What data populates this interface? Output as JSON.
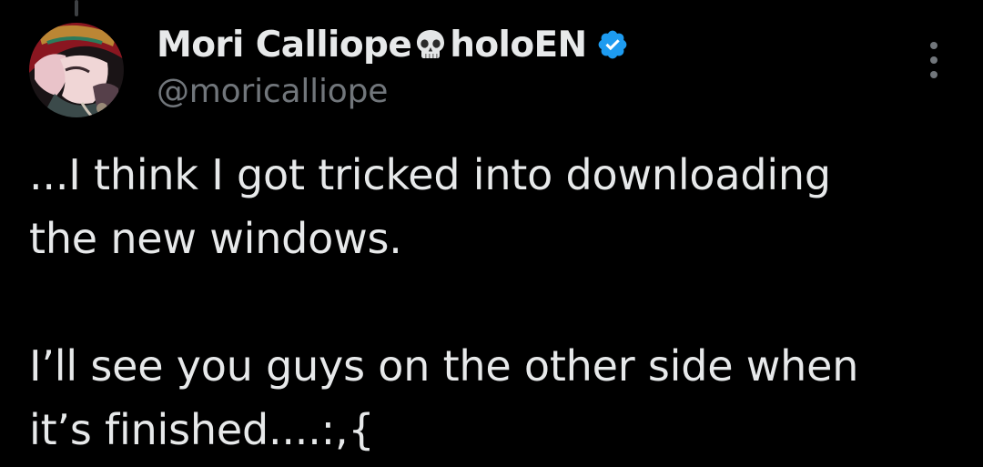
{
  "tweet": {
    "author": {
      "display_name": "Mori Calliope",
      "name_suffix": "holoEN",
      "handle": "@moricalliope",
      "name_emoji": "skull-icon",
      "verified_badge": "verified-badge-icon",
      "avatar": "profile-avatar"
    },
    "text": {
      "line1": "...I think I got tricked into downloading",
      "line2": "the new windows.",
      "line3": "I’ll see you guys on the other side when",
      "line4": "it’s finished....:,{"
    },
    "more_icon": "more-options-icon"
  },
  "colors": {
    "background": "#000000",
    "primary_text": "#e7e9ea",
    "secondary_text": "#71767b",
    "verified_blue": "#1d9bf0"
  }
}
